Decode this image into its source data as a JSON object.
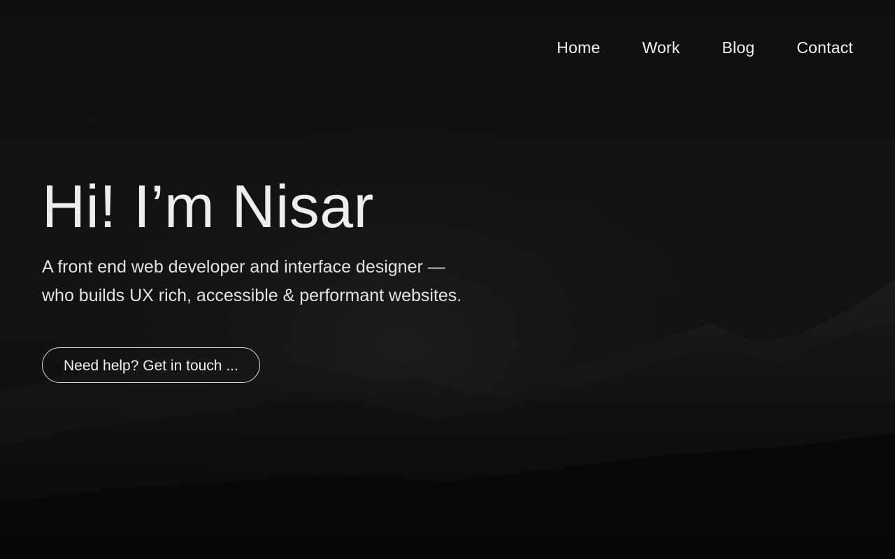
{
  "nav": {
    "items": [
      {
        "label": "Home"
      },
      {
        "label": "Work"
      },
      {
        "label": "Blog"
      },
      {
        "label": "Contact"
      }
    ]
  },
  "hero": {
    "title": "Hi! I’m Nisar",
    "subtitle_line1": "A front end web developer and interface designer —",
    "subtitle_line2": "who builds UX rich, accessible & performant websites.",
    "cta_label": "Need help? Get in touch ..."
  },
  "colors": {
    "background": "#0c0e10",
    "text": "#ececec",
    "button_border": "#d8d8d8"
  }
}
